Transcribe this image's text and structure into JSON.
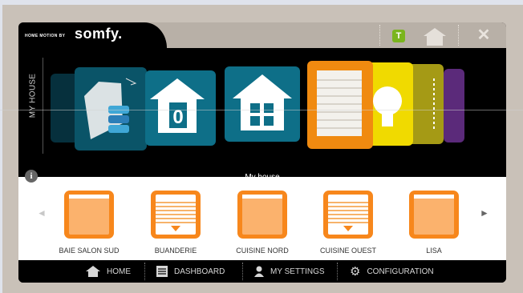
{
  "brand": {
    "tagline": "HOME MOTION BY",
    "logo": "somfy."
  },
  "header": {
    "badge_letter": "T",
    "icons": [
      "home-icon",
      "close-icon"
    ]
  },
  "side_label": "MY HOUSE",
  "stage_title": "My house",
  "devices": [
    {
      "label": "BAIE SALON SUD",
      "type": "plain"
    },
    {
      "label": "BUANDERIE",
      "type": "slats"
    },
    {
      "label": "CUISINE NORD",
      "type": "plain"
    },
    {
      "label": "CUISINE OUEST",
      "type": "slats"
    },
    {
      "label": "LISA",
      "type": "plain"
    }
  ],
  "nav": [
    {
      "label": "HOME",
      "icon": "house-icon"
    },
    {
      "label": "DASHBOARD",
      "icon": "dashboard-icon"
    },
    {
      "label": "MY SETTINGS",
      "icon": "user-icon"
    },
    {
      "label": "CONFIGURATION",
      "icon": "gear-icon"
    }
  ],
  "colors": {
    "accent": "#f7871c",
    "teal": "#0e6f88",
    "badge_green": "#7ab51d"
  }
}
